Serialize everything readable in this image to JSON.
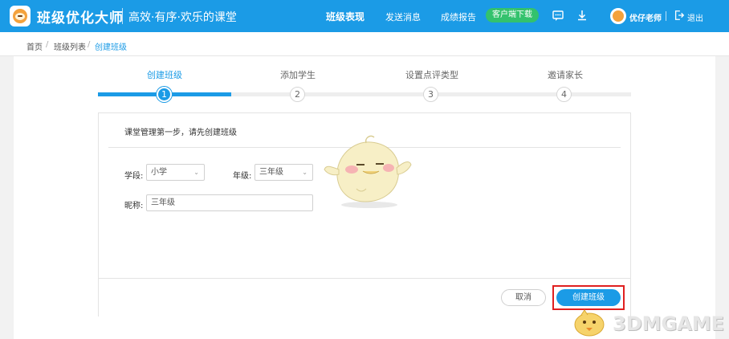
{
  "header": {
    "brand": "班级优化大师",
    "slogan": "高效·有序·欢乐的课堂",
    "nav": [
      "班级表现",
      "发送消息",
      "成绩报告"
    ],
    "download_label": "客户端下载",
    "user_name": "优仔老师",
    "logout_label": "退出",
    "icons": [
      "chat-icon",
      "download-icon",
      "logout-icon"
    ]
  },
  "breadcrumb": [
    "首页",
    "班级列表",
    "创建班级"
  ],
  "steps": [
    {
      "label": "创建班级",
      "number": "1"
    },
    {
      "label": "添加学生",
      "number": "2"
    },
    {
      "label": "设置点评类型",
      "number": "3"
    },
    {
      "label": "邀请家长",
      "number": "4"
    }
  ],
  "form": {
    "title": "课堂管理第一步，请先创建班级",
    "stage_label": "学段:",
    "stage_value": "小学",
    "grade_label": "年级:",
    "grade_value": "三年级",
    "nickname_label": "昵称:",
    "nickname_value": "三年级"
  },
  "actions": {
    "cancel_label": "取消",
    "create_label": "创建班级"
  },
  "watermark": "3DMGAME",
  "colors": {
    "primary": "#1b9be6",
    "download": "#33c26d",
    "highlight": "#e02020"
  }
}
